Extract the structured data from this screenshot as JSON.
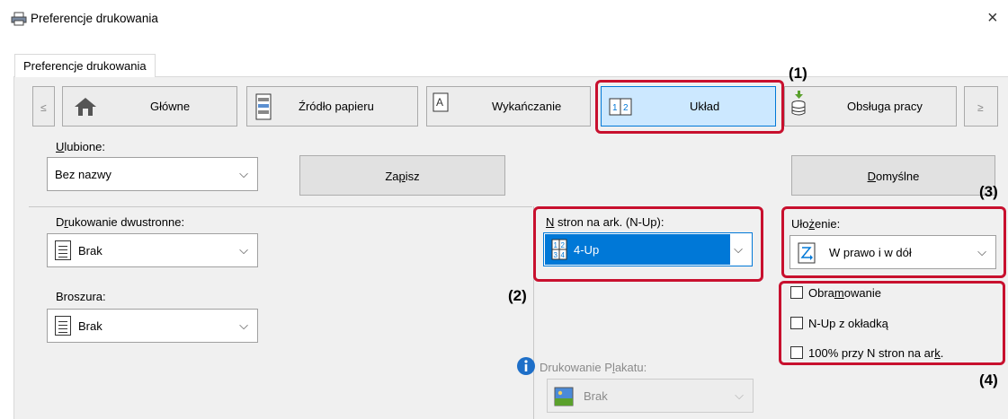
{
  "window": {
    "title": "Preferencje drukowania",
    "close": "×"
  },
  "tab": {
    "label": "Preferencje drukowania"
  },
  "nav": {
    "prev": "≤",
    "next": "≥",
    "items": [
      {
        "label": "Główne"
      },
      {
        "label": "Źródło papieru"
      },
      {
        "label": "Wykańczanie"
      },
      {
        "label": "Układ"
      },
      {
        "label": "Obsługa pracy"
      }
    ]
  },
  "favorites": {
    "label": "Ulubione:",
    "value": "Bez nazwy",
    "save": "Zapisz",
    "defaults": "Domyślne"
  },
  "duplex": {
    "label": "Drukowanie dwustronne:",
    "value": "Brak"
  },
  "booklet": {
    "label": "Broszura:",
    "value": "Brak"
  },
  "nup": {
    "label": "N stron na ark. (N-Up):",
    "value": "4-Up"
  },
  "order": {
    "label": "Ułożenie:",
    "value": "W prawo i w dół"
  },
  "checkboxes": {
    "border": "Obramowanie",
    "cover": "N-Up z okładką",
    "hundred": "100% przy N stron na ark."
  },
  "poster": {
    "label": "Drukowanie Plakatu:",
    "value": "Brak"
  },
  "callouts": {
    "c1": "(1)",
    "c2": "(2)",
    "c3": "(3)",
    "c4": "(4)"
  },
  "colors": {
    "accent": "#0078d7",
    "highlight": "#c8102e",
    "selected_bg": "#cce8ff"
  }
}
